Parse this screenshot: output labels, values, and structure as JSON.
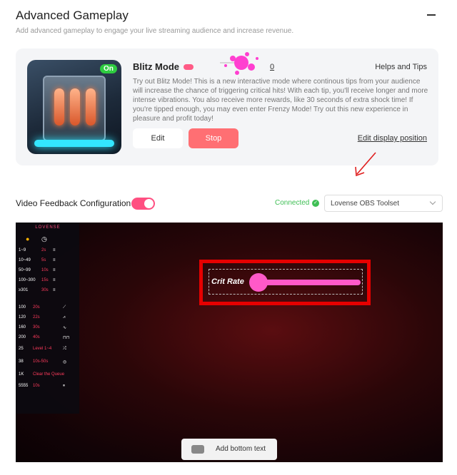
{
  "header": {
    "title": "Advanced Gameplay",
    "subtitle": "Add advanced gameplay to engage your live streaming audience and increase revenue."
  },
  "blitz": {
    "badge": "On",
    "title": "Blitz Mode",
    "count": "0",
    "help_label": "Helps and Tips",
    "description": "Try out Blitz Mode! This is a new interactive mode where continous tips from your audience will increase the chance of triggering critical hits! With each tip, you'll receive longer and more intense vibrations. You also receive more rewards, like 30 seconds of extra shock time! If you're tipped enough, you may even enter Frenzy Mode! Try out this new experience in pleasure and profit today!",
    "edit_label": "Edit",
    "stop_label": "Stop",
    "edit_position_label": "Edit display position"
  },
  "video_feedback": {
    "label": "Video Feedback Configuration",
    "enabled": true,
    "status": "Connected",
    "toolset": "Lovense OBS Toolset"
  },
  "preview": {
    "brand": "LOVENSE",
    "levels": [
      {
        "range": "1~9",
        "time": "2s"
      },
      {
        "range": "10~49",
        "time": "5s"
      },
      {
        "range": "50~99",
        "time": "10s"
      },
      {
        "range": "100~300",
        "time": "15s"
      },
      {
        "range": "≥301",
        "time": "30s"
      }
    ],
    "patterns": [
      {
        "amount": "100",
        "time": "20s",
        "icon": "⟋"
      },
      {
        "amount": "120",
        "time": "22s",
        "icon": "⩘"
      },
      {
        "amount": "160",
        "time": "30s",
        "icon": "∿"
      },
      {
        "amount": "200",
        "time": "40s",
        "icon": "⊓⊓"
      },
      {
        "amount": "25",
        "time": "Level 1~4",
        "icon": "⤮"
      },
      {
        "amount": "38",
        "time": "10s-50s",
        "icon": "◎"
      },
      {
        "amount": "1K",
        "time": "Clear the Queue",
        "icon": ""
      },
      {
        "amount": "5555",
        "time": "10s",
        "icon": "⏸"
      }
    ],
    "crit_label": "Crit Rate",
    "add_text_label": "Add bottom text"
  },
  "colors": {
    "accent": "#ff4f81",
    "stop": "#ff6f73",
    "connected": "#3fbf55",
    "highlight": "#e60000",
    "crit_bar": "#ff59c8"
  }
}
